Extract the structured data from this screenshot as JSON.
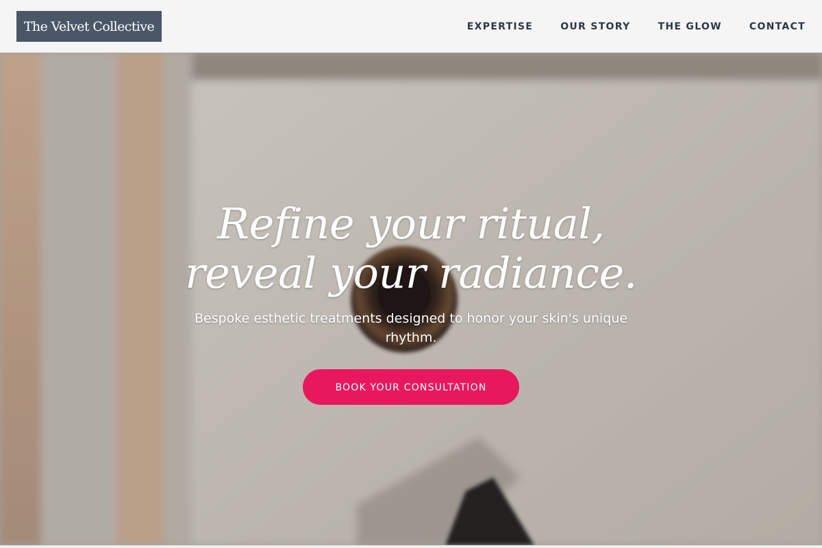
{
  "header": {
    "logo_text": "The Velvet Collective",
    "nav": [
      {
        "label": "EXPERTISE"
      },
      {
        "label": "OUR STORY"
      },
      {
        "label": "THE GLOW"
      },
      {
        "label": "CONTACT"
      }
    ]
  },
  "hero": {
    "headline_line1": "Refine your ritual,",
    "headline_line2": "reveal your radiance.",
    "subtext": "Bespoke esthetic treatments designed to honor your skin's unique rhythm.",
    "cta_label": "BOOK YOUR CONSULTATION"
  },
  "colors": {
    "logo_bg": "#4a5767",
    "nav_text": "#2d3845",
    "cta_bg": "#e8185f",
    "header_bg": "#f5f5f5"
  }
}
